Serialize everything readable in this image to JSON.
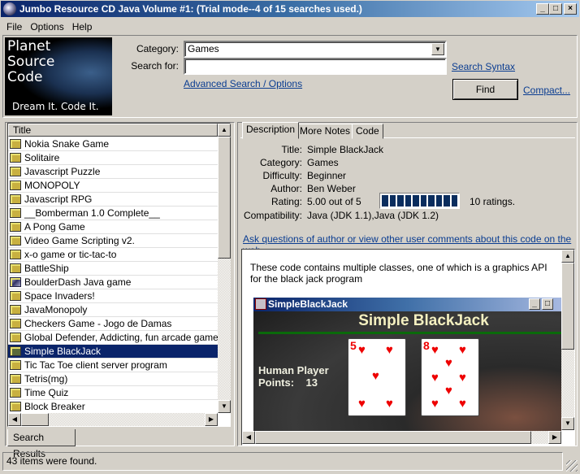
{
  "window": {
    "title": "Jumbo Resource CD Java Volume #1: (Trial mode--4 of 15 searches used.)",
    "minimize": "_",
    "maximize": "□",
    "close": "×"
  },
  "menu": [
    "File",
    "Options",
    "Help"
  ],
  "logo": {
    "line1": "Planet",
    "line2": "Source",
    "line3": "Code",
    "tagline": "Dream It.  Code It."
  },
  "search": {
    "category_label": "Category:",
    "category_value": "Games",
    "searchfor_label": "Search for:",
    "searchfor_value": "",
    "search_syntax_link": "Search Syntax",
    "advanced_link": "Advanced Search / Options",
    "find_button": "Find",
    "compact_link": "Compact..."
  },
  "results": {
    "column_header": "Title",
    "items": [
      {
        "title": "Nokia Snake Game",
        "icon": "code-icon"
      },
      {
        "title": "Solitaire",
        "icon": "code-icon"
      },
      {
        "title": "Javascript Puzzle",
        "icon": "code-icon"
      },
      {
        "title": "MONOPOLY",
        "icon": "code-icon"
      },
      {
        "title": "Javascript RPG",
        "icon": "code-icon"
      },
      {
        "title": "__Bomberman 1.0 Complete__",
        "icon": "code-icon"
      },
      {
        "title": "A Pong Game",
        "icon": "code-icon"
      },
      {
        "title": "Video Game Scripting v2.",
        "icon": "code-icon"
      },
      {
        "title": "x-o game  or tic-tac-to",
        "icon": "code-icon"
      },
      {
        "title": "BattleShip",
        "icon": "code-icon"
      },
      {
        "title": "BoulderDash Java game",
        "icon": "package-icon"
      },
      {
        "title": "Space Invaders!",
        "icon": "code-icon"
      },
      {
        "title": "JavaMonopoly",
        "icon": "code-icon"
      },
      {
        "title": "Checkers Game - Jogo de Damas",
        "icon": "code-icon"
      },
      {
        "title": "Global Defender, Addicting, fun arcade game, Upc",
        "icon": "code-icon"
      },
      {
        "title": "Simple BlackJack",
        "icon": "code-icon",
        "selected": true
      },
      {
        "title": "Tic Tac Toe client server program",
        "icon": "code-icon"
      },
      {
        "title": "Tetris(mg)",
        "icon": "code-icon"
      },
      {
        "title": "Time Quiz",
        "icon": "code-icon"
      },
      {
        "title": "Block Breaker",
        "icon": "code-icon"
      }
    ],
    "tab_label": "Search Results"
  },
  "detail": {
    "tabs": [
      "Description",
      "More Notes",
      "Code"
    ],
    "active_tab": "Description",
    "fields": {
      "title_label": "Title:",
      "title": "Simple BlackJack",
      "category_label": "Category:",
      "category": "Games",
      "difficulty_label": "Difficulty:",
      "difficulty": "Beginner",
      "author_label": "Author:",
      "author": "Ben Weber",
      "rating_label": "Rating:",
      "rating": "5.00 out of 5",
      "rating_fraction": 1.0,
      "rating_count": "10 ratings.",
      "compat_label": "Compatibility:",
      "compatibility": "Java (JDK 1.1),Java (JDK 1.2)"
    },
    "web_link": "Ask questions of author or view other user comments about this code on the web...",
    "description": "These code contains multiple classes, one of which is a graphics API for the black jack program",
    "screenshot": {
      "window_title": "SimpleBlackJack",
      "heading": "Simple BlackJack",
      "player_label": "Human Player",
      "points_label": "Points:",
      "points": "13",
      "cards": [
        {
          "rank": "5",
          "suit": "♥"
        },
        {
          "rank": "8",
          "suit": "♥"
        }
      ]
    }
  },
  "status": "43 items were found."
}
